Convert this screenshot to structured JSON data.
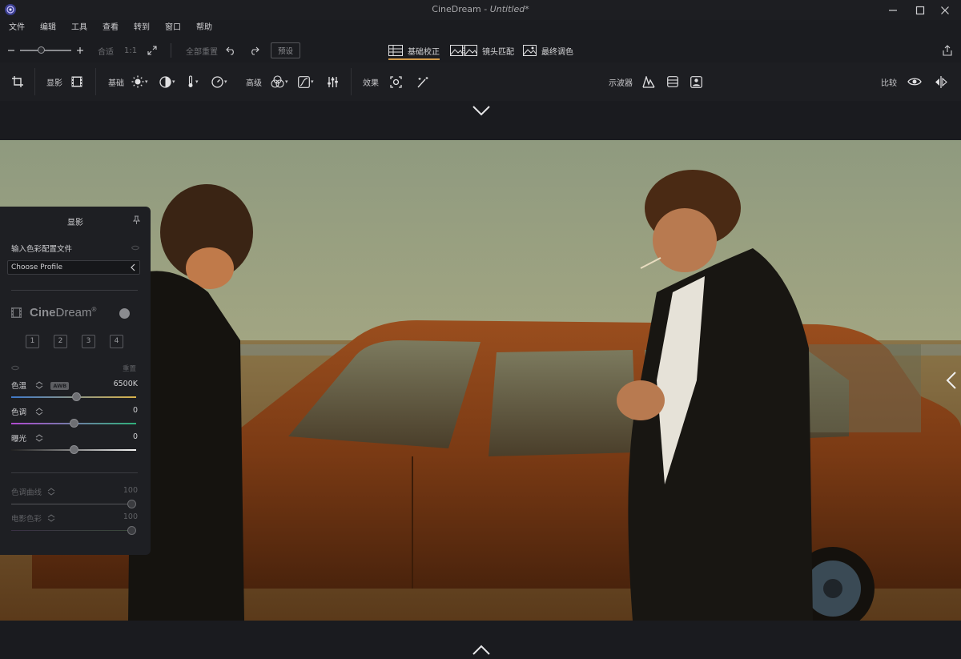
{
  "window": {
    "app_name": "CineDream",
    "separator": " - ",
    "document": "Untitled*"
  },
  "menu": [
    "文件",
    "编辑",
    "工具",
    "查看",
    "转到",
    "窗口",
    "帮助"
  ],
  "toolbar": {
    "fit_label": "合适",
    "one_to_one_label": "1:1",
    "reset_all_label": "全部重置",
    "preset_label": "预设",
    "zoom_level": 0.42,
    "modes": [
      {
        "label": "基础校正",
        "active": true
      },
      {
        "label": "镜头匹配",
        "active": false
      },
      {
        "label": "最终调色",
        "active": false
      }
    ]
  },
  "ribbon": {
    "develop_label": "显影",
    "basic_label": "基础",
    "advanced_label": "高级",
    "effects_label": "效果",
    "scopes_label": "示波器",
    "compare_label": "比较"
  },
  "panel": {
    "title": "显影",
    "input_profile_label": "输入色彩配置文件",
    "profile_value": "Choose Profile",
    "brand_cine": "Cine",
    "brand_dream": "Dream",
    "brand_reg": "®",
    "presets": [
      "1",
      "2",
      "3",
      "4"
    ],
    "reset_label": "重置",
    "sliders": [
      {
        "label": "色温",
        "value": "6500K",
        "awb": "AWB",
        "position": 0.52
      },
      {
        "label": "色调",
        "value": "0",
        "position": 0.5
      },
      {
        "label": "曝光",
        "value": "0",
        "position": 0.5
      }
    ],
    "dim_sliders": [
      {
        "label": "色调曲线",
        "value": "100",
        "position": 1.0
      },
      {
        "label": "电影色彩",
        "value": "100",
        "position": 1.0
      }
    ]
  },
  "colors": {
    "accent": "#d39a4a",
    "background": "#1b1c20",
    "panel": "#1e1f23"
  }
}
